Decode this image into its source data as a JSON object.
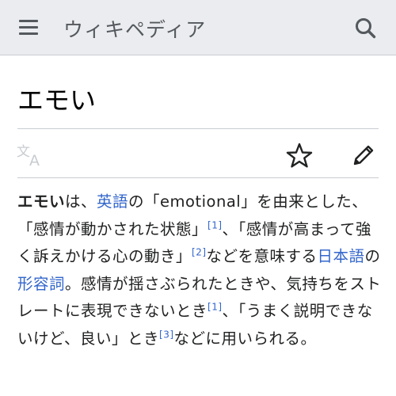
{
  "header": {
    "site_title": "ウィキペディア",
    "menu_icon": "hamburger-menu-icon",
    "search_icon": "search-icon"
  },
  "page": {
    "title": "エモい"
  },
  "actions": {
    "language_icon": "translate-language-icon",
    "watch_icon": "star-icon",
    "edit_icon": "pencil-edit-icon"
  },
  "article": {
    "term": "エモい",
    "t1": "は、",
    "link_english": "英語",
    "t2": "の「emotional」を由来とした、「感情が動かされた状態」",
    "ref1": "[1]",
    "t3": "、「感情が高まって強く訴えかける心の動き」",
    "ref2": "[2]",
    "t4": "などを意味する",
    "link_japanese": "日本語",
    "t5": "の",
    "link_adjective": "形容詞",
    "t6": "。感情が揺さぶられたときや、気持ちをストレートに表現できないとき",
    "ref3": "[1]",
    "t7": "、「うまく説明できないけど、良い」とき",
    "ref4": "[3]",
    "t8": "などに用いられる。"
  }
}
